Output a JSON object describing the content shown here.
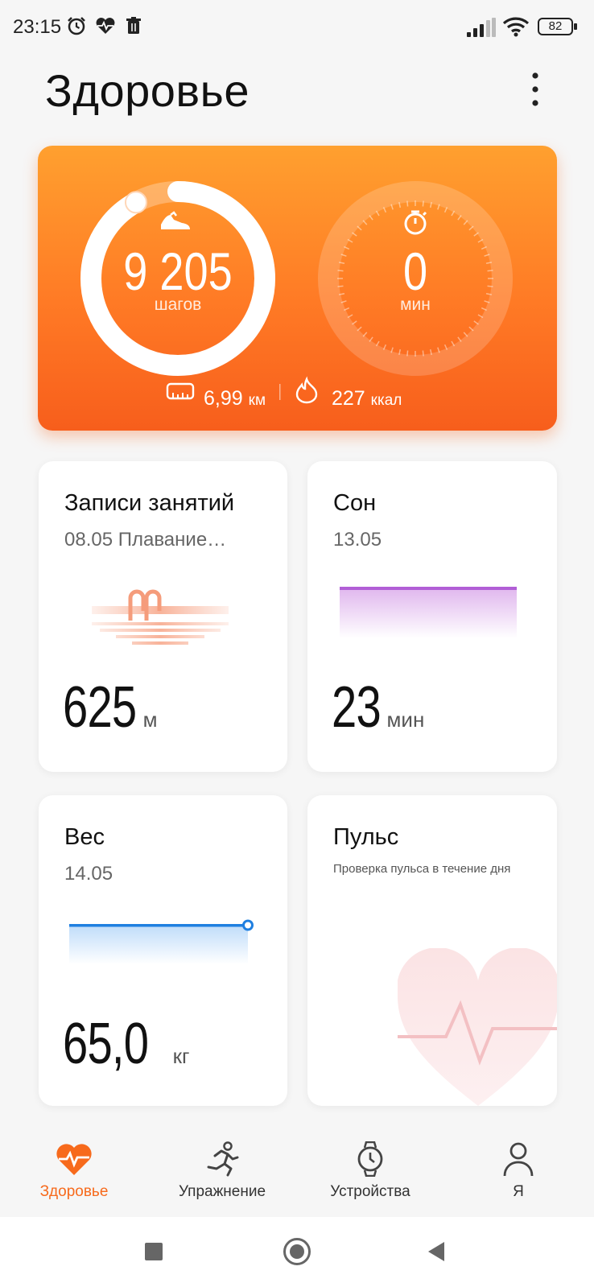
{
  "status_bar": {
    "time": "23:15",
    "battery": "82",
    "icons": [
      "alarm-icon",
      "heart-pulse-icon",
      "trash-icon",
      "signal-icon",
      "wifi-icon",
      "battery-icon"
    ]
  },
  "header": {
    "title": "Здоровье",
    "more_icon": "more-vertical-icon"
  },
  "summary": {
    "steps_value": "9 205",
    "steps_unit": "шагов",
    "steps_progress": 0.92,
    "active_value": "0",
    "active_unit": "мин",
    "distance_value": "6,99",
    "distance_unit": "км",
    "calories_value": "227",
    "calories_unit": "ккал"
  },
  "cards": {
    "workouts": {
      "title": "Записи занятий",
      "subtitle": "08.05 Плавание…",
      "value": "625",
      "unit": "м"
    },
    "sleep": {
      "title": "Сон",
      "subtitle": "13.05",
      "value": "23",
      "unit": "мин"
    },
    "weight": {
      "title": "Вес",
      "subtitle": "14.05",
      "value": "65,0",
      "unit": "кг"
    },
    "pulse": {
      "title": "Пульс",
      "description": "Проверка пульса в течение дня"
    }
  },
  "bottom_nav": {
    "items": [
      {
        "label": "Здоровье",
        "icon": "heart-health-icon",
        "active": true
      },
      {
        "label": "Упражнение",
        "icon": "running-icon",
        "active": false
      },
      {
        "label": "Устройства",
        "icon": "watch-icon",
        "active": false
      },
      {
        "label": "Я",
        "icon": "person-icon",
        "active": false
      }
    ]
  },
  "colors": {
    "accent": "#f76a1c",
    "sleep": "#b15ed6",
    "weight": "#1f7fe0"
  }
}
